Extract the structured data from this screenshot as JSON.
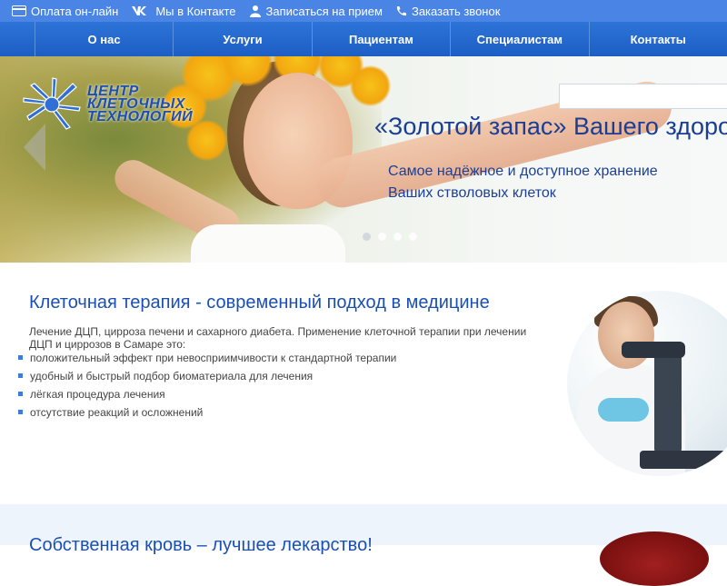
{
  "topbar": {
    "items": [
      {
        "label": "Оплата он-лайн",
        "icon": "credit-card-icon"
      },
      {
        "label": "Мы в Контакте",
        "icon": "vk-icon"
      },
      {
        "label": "Записаться на прием",
        "icon": "doctor-icon"
      },
      {
        "label": "Заказать звонок",
        "icon": "phone-icon"
      }
    ]
  },
  "nav": {
    "items": [
      {
        "label": "О нас"
      },
      {
        "label": "Услуги"
      },
      {
        "label": "Пациентам"
      },
      {
        "label": "Специалистам"
      },
      {
        "label": "Контакты"
      }
    ]
  },
  "hero": {
    "logo_lines": [
      "ЦЕНТР",
      "КЛЕТОЧНЫХ",
      "ТЕХНОЛОГИЙ"
    ],
    "title": "«Золотой запас» Вашего здоровья",
    "subtitle_line1": "Самое надёжное и доступное хранение",
    "subtitle_line2": "Ваших стволовых клеток",
    "search_placeholder": "",
    "slides_total": 4,
    "active_slide": 1
  },
  "section1": {
    "title": "Клеточная терапия - современный подход в медицине",
    "intro": "Лечение ДЦП, цирроза печени и сахарного диабета. Применение клеточной терапии при лечении ДЦП и циррозов в Самаре это:",
    "bullets": [
      "положительный эффект при невосприимчивости к стандартной терапии",
      "удобный и быстрый подбор биоматериала для лечения",
      "лёгкая процедура лечения",
      "отсутствие реакций и осложнений"
    ]
  },
  "section2": {
    "title": "Собственная кровь – лучшее лекарство!"
  },
  "colors": {
    "topbar": "#4a84e4",
    "nav": "#2d74d8",
    "heading": "#1a4fb4",
    "hero_text": "#1a3e94"
  }
}
